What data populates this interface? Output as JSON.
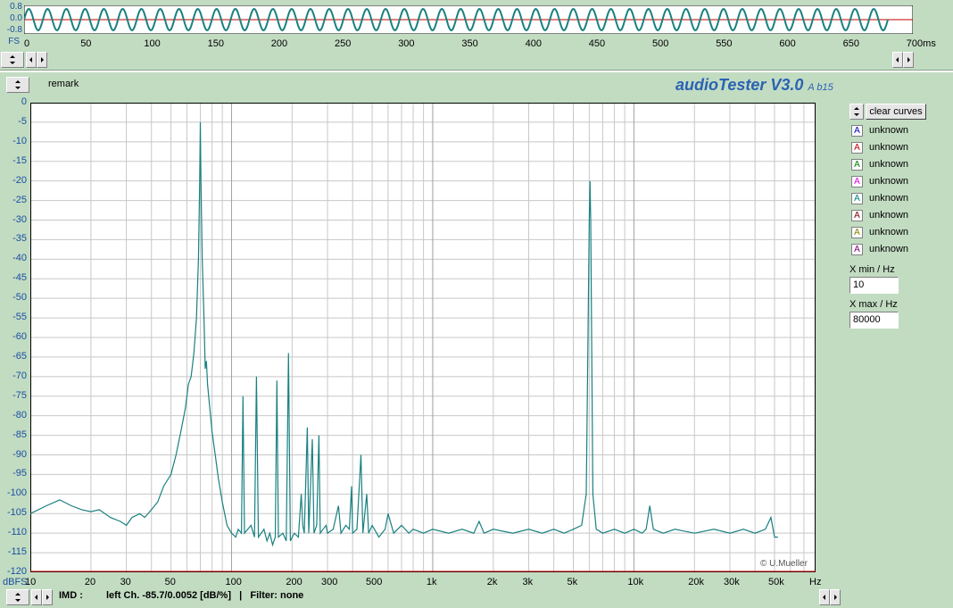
{
  "time_strip": {
    "y_labels": [
      "0.8",
      "0.0",
      "-0.8"
    ],
    "fs_label": "FS",
    "ticks": [
      "0",
      "50",
      "100",
      "150",
      "200",
      "250",
      "300",
      "350",
      "400",
      "450",
      "500",
      "550",
      "600",
      "650",
      "700ms"
    ]
  },
  "header": {
    "remark": "remark",
    "app_title": "audioTester V3.0",
    "app_version": "A b15"
  },
  "sidebar": {
    "clear_curves": "clear curves",
    "curves": [
      {
        "mark": "A",
        "label": "unknown",
        "color": "#0000c0"
      },
      {
        "mark": "A",
        "label": "unknown",
        "color": "#c00000"
      },
      {
        "mark": "A",
        "label": "unknown",
        "color": "#008000"
      },
      {
        "mark": "A",
        "label": "unknown",
        "color": "#e000e0"
      },
      {
        "mark": "A",
        "label": "unknown",
        "color": "#008080"
      },
      {
        "mark": "A",
        "label": "unknown",
        "color": "#800000"
      },
      {
        "mark": "A",
        "label": "unknown",
        "color": "#808000"
      },
      {
        "mark": "A",
        "label": "unknown",
        "color": "#800080"
      }
    ],
    "xmin_label": "X min / Hz",
    "xmin_value": "10",
    "xmax_label": "X max / Hz",
    "xmax_value": "80000"
  },
  "footer": {
    "mode": "IMD :",
    "result": "left Ch. -85.7/0.0052 [dB/%]   |   Filter: none"
  },
  "chart_data": {
    "type": "line",
    "xscale": "log",
    "xlim": [
      10,
      80000
    ],
    "ylim": [
      -120,
      0
    ],
    "grid": true,
    "ylabel": "dBFS",
    "xlabel": "Hz",
    "y_ticks": [
      "0",
      "-5",
      "-10",
      "-15",
      "-20",
      "-25",
      "-30",
      "-35",
      "-40",
      "-45",
      "-50",
      "-55",
      "-60",
      "-65",
      "-70",
      "-75",
      "-80",
      "-85",
      "-90",
      "-95",
      "-100",
      "-105",
      "-110",
      "-115",
      "-120"
    ],
    "x_ticks": [
      {
        "v": 20,
        "t": "20"
      },
      {
        "v": 30,
        "t": "30"
      },
      {
        "v": 50,
        "t": "50"
      },
      {
        "v": 100,
        "t": "100"
      },
      {
        "v": 200,
        "t": "200"
      },
      {
        "v": 300,
        "t": "300"
      },
      {
        "v": 500,
        "t": "500"
      },
      {
        "v": 1000,
        "t": "1k"
      },
      {
        "v": 2000,
        "t": "2k"
      },
      {
        "v": 3000,
        "t": "3k"
      },
      {
        "v": 5000,
        "t": "5k"
      },
      {
        "v": 10000,
        "t": "10k"
      },
      {
        "v": 20000,
        "t": "20k"
      },
      {
        "v": 30000,
        "t": "30k"
      },
      {
        "v": 50000,
        "t": "50k"
      }
    ],
    "x_first_label": "10",
    "watermark": "© U.Mueller",
    "series": [
      {
        "color": "#1a8080",
        "points": [
          [
            10,
            -105
          ],
          [
            12,
            -103
          ],
          [
            14,
            -101.5
          ],
          [
            16,
            -103
          ],
          [
            18,
            -104
          ],
          [
            20,
            -104.5
          ],
          [
            22,
            -104
          ],
          [
            25,
            -106
          ],
          [
            28,
            -107
          ],
          [
            30,
            -108
          ],
          [
            32,
            -106
          ],
          [
            35,
            -105
          ],
          [
            37,
            -106
          ],
          [
            40,
            -104
          ],
          [
            43,
            -102
          ],
          [
            46,
            -98
          ],
          [
            50,
            -95
          ],
          [
            53,
            -90
          ],
          [
            56,
            -84
          ],
          [
            59,
            -78
          ],
          [
            61,
            -72
          ],
          [
            63,
            -70
          ],
          [
            65,
            -64
          ],
          [
            67,
            -55
          ],
          [
            68.5,
            -40
          ],
          [
            69.5,
            -20
          ],
          [
            70,
            -5
          ],
          [
            70.5,
            -20
          ],
          [
            71.5,
            -40
          ],
          [
            73,
            -55
          ],
          [
            74,
            -68
          ],
          [
            75,
            -66
          ],
          [
            76,
            -72
          ],
          [
            78,
            -78
          ],
          [
            80,
            -84
          ],
          [
            83,
            -90
          ],
          [
            86,
            -96
          ],
          [
            90,
            -102
          ],
          [
            95,
            -108
          ],
          [
            100,
            -110
          ],
          [
            105,
            -111
          ],
          [
            108,
            -109
          ],
          [
            112,
            -110
          ],
          [
            114,
            -75
          ],
          [
            116,
            -110
          ],
          [
            125,
            -108
          ],
          [
            130,
            -111
          ],
          [
            133,
            -70
          ],
          [
            136,
            -111
          ],
          [
            145,
            -109
          ],
          [
            150,
            -112
          ],
          [
            155,
            -110
          ],
          [
            160,
            -113
          ],
          [
            165,
            -111
          ],
          [
            168,
            -71
          ],
          [
            171,
            -111
          ],
          [
            180,
            -110
          ],
          [
            187,
            -112
          ],
          [
            192,
            -64
          ],
          [
            196,
            -112
          ],
          [
            205,
            -110
          ],
          [
            215,
            -111
          ],
          [
            222,
            -100
          ],
          [
            226,
            -108
          ],
          [
            230,
            -110
          ],
          [
            238,
            -83
          ],
          [
            242,
            -110
          ],
          [
            252,
            -86
          ],
          [
            257,
            -110
          ],
          [
            265,
            -108
          ],
          [
            272,
            -85
          ],
          [
            276,
            -110
          ],
          [
            285,
            -109
          ],
          [
            295,
            -108
          ],
          [
            300,
            -110
          ],
          [
            320,
            -109
          ],
          [
            340,
            -103
          ],
          [
            350,
            -110
          ],
          [
            370,
            -108
          ],
          [
            385,
            -109
          ],
          [
            395,
            -98
          ],
          [
            400,
            -110
          ],
          [
            420,
            -109
          ],
          [
            440,
            -90
          ],
          [
            450,
            -110
          ],
          [
            470,
            -100
          ],
          [
            480,
            -110
          ],
          [
            500,
            -108
          ],
          [
            540,
            -111
          ],
          [
            580,
            -109
          ],
          [
            600,
            -105
          ],
          [
            640,
            -110
          ],
          [
            700,
            -108
          ],
          [
            760,
            -110
          ],
          [
            800,
            -109
          ],
          [
            900,
            -110
          ],
          [
            1000,
            -109
          ],
          [
            1200,
            -110
          ],
          [
            1400,
            -109
          ],
          [
            1600,
            -110
          ],
          [
            1700,
            -107
          ],
          [
            1800,
            -110
          ],
          [
            2000,
            -109
          ],
          [
            2500,
            -110
          ],
          [
            3000,
            -109
          ],
          [
            3500,
            -110
          ],
          [
            4000,
            -109
          ],
          [
            4500,
            -110
          ],
          [
            5000,
            -109
          ],
          [
            5500,
            -108
          ],
          [
            5800,
            -100
          ],
          [
            6000,
            -30
          ],
          [
            6050,
            -20
          ],
          [
            6100,
            -30
          ],
          [
            6250,
            -100
          ],
          [
            6500,
            -109
          ],
          [
            7000,
            -110
          ],
          [
            8000,
            -109
          ],
          [
            9000,
            -110
          ],
          [
            10000,
            -109
          ],
          [
            11000,
            -110
          ],
          [
            11500,
            -109
          ],
          [
            12000,
            -103
          ],
          [
            12500,
            -109
          ],
          [
            14000,
            -110
          ],
          [
            16000,
            -109
          ],
          [
            20000,
            -110
          ],
          [
            25000,
            -109
          ],
          [
            30000,
            -110
          ],
          [
            35000,
            -109
          ],
          [
            40000,
            -110
          ],
          [
            45000,
            -109
          ],
          [
            48000,
            -106
          ],
          [
            50000,
            -111
          ],
          [
            52000,
            -111
          ]
        ]
      }
    ]
  }
}
